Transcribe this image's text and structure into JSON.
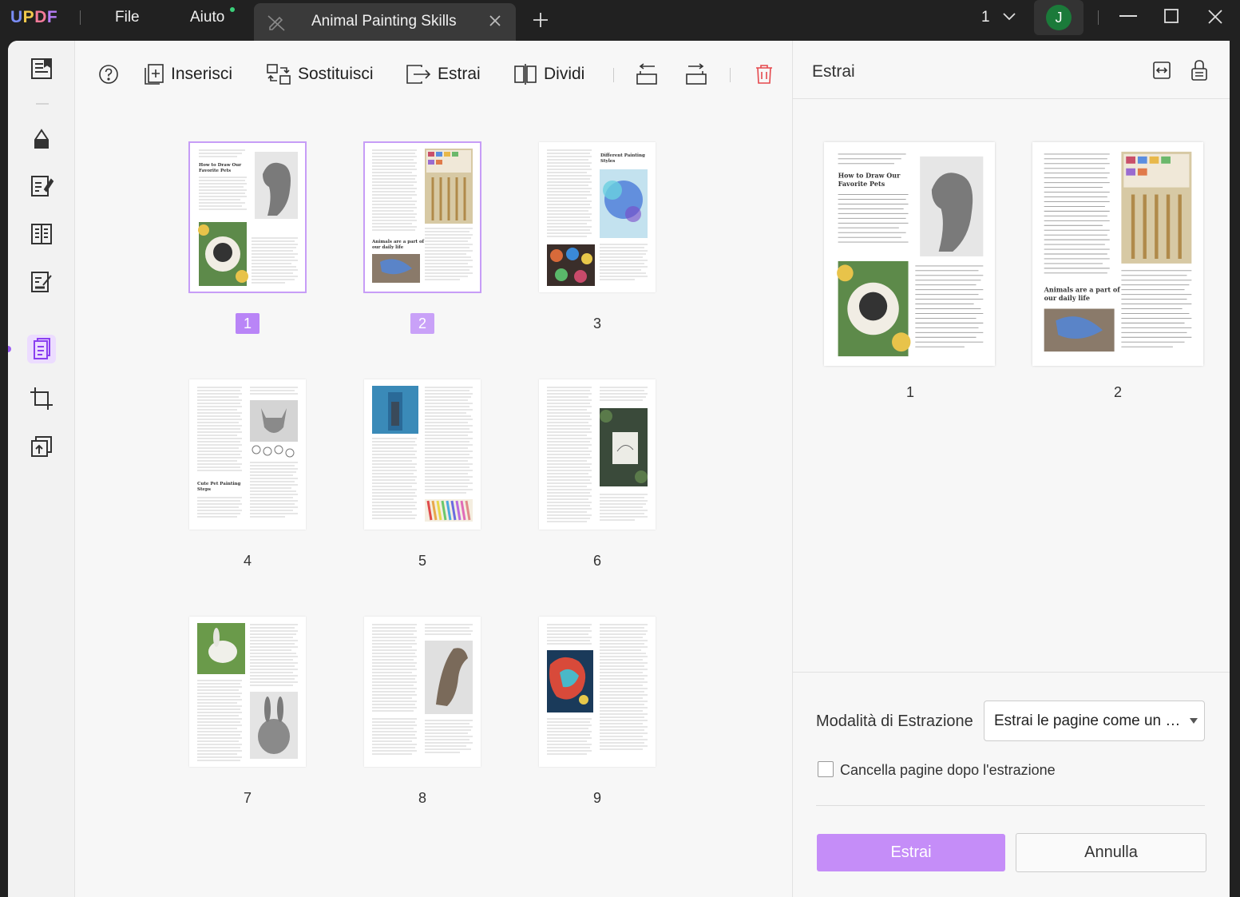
{
  "app": {
    "logo": "UPDF",
    "menu": [
      "File",
      "Aiuto"
    ],
    "tab_title": "Animal Painting Skills",
    "page_indicator": "1",
    "avatar_initial": "J"
  },
  "toolbar": {
    "insert_label": "Inserisci",
    "replace_label": "Sostituisci",
    "extract_label": "Estrai",
    "split_label": "Dividi"
  },
  "pages": [
    {
      "label": "1",
      "selected": true,
      "title": "How to Draw Our Favorite Pets"
    },
    {
      "label": "2",
      "selected": true,
      "title": "Animals are a part of our daily life"
    },
    {
      "label": "3",
      "selected": false,
      "title": "Different Painting Styles"
    },
    {
      "label": "4",
      "selected": false,
      "title": "Cute Pet Painting Steps"
    },
    {
      "label": "5",
      "selected": false,
      "title": ""
    },
    {
      "label": "6",
      "selected": false,
      "title": ""
    },
    {
      "label": "7",
      "selected": false,
      "title": ""
    },
    {
      "label": "8",
      "selected": false,
      "title": ""
    },
    {
      "label": "9",
      "selected": false,
      "title": ""
    }
  ],
  "panel": {
    "title": "Estrai",
    "preview_pages": [
      "1",
      "2"
    ],
    "preview_titles": [
      "How to Draw Our Favorite Pets",
      "Animals are a part of our daily life"
    ],
    "mode_label": "Modalità di Estrazione",
    "mode_value": "Estrai le pagine come un uni...",
    "delete_after_label": "Cancella pagine dopo l'estrazione",
    "delete_after_checked": false,
    "extract_button": "Estrai",
    "cancel_button": "Annulla"
  },
  "colors": {
    "accent": "#b985f7",
    "accent_light": "#c58df8",
    "titlebar": "#212121",
    "delete_red": "#e5484d"
  },
  "icons": [
    "help-icon",
    "insert-icon",
    "replace-icon",
    "extract-icon",
    "split-icon",
    "rotate-left-icon",
    "rotate-right-icon",
    "trash-icon",
    "fit-width-icon",
    "lock-icon"
  ]
}
